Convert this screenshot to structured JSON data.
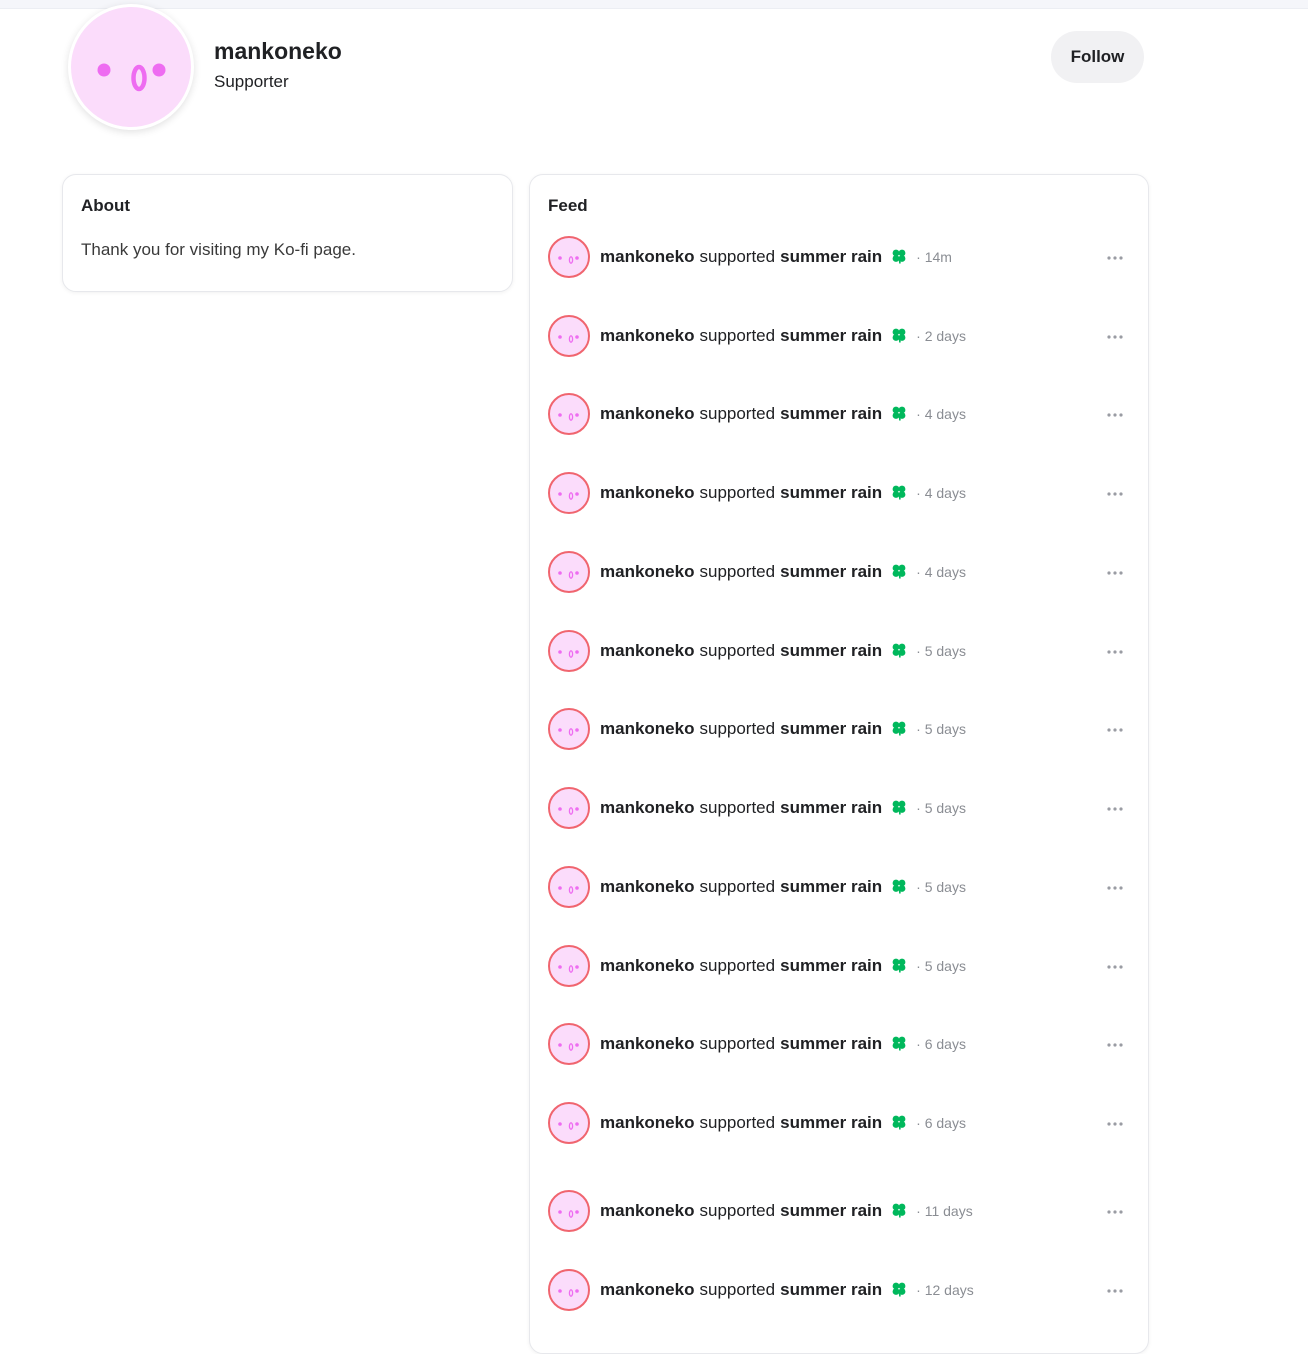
{
  "profile": {
    "name": "mankoneko",
    "role": "Supporter",
    "follow_label": "Follow",
    "avatar_bg": "#fbdcfb",
    "avatar_feature_color": "#ee6cf1"
  },
  "about": {
    "title": "About",
    "text": "Thank you for visiting my Ko-fi page."
  },
  "feed": {
    "title": "Feed",
    "accent_ring_color": "#f0656f",
    "clover_color": "#00b85c",
    "items": [
      {
        "user": "mankoneko",
        "verb": "supported",
        "target": "summer rain",
        "time": "· 14m"
      },
      {
        "user": "mankoneko",
        "verb": "supported",
        "target": "summer rain",
        "time": "· 2 days"
      },
      {
        "user": "mankoneko",
        "verb": "supported",
        "target": "summer rain",
        "time": "· 4 days"
      },
      {
        "user": "mankoneko",
        "verb": "supported",
        "target": "summer rain",
        "time": "· 4 days"
      },
      {
        "user": "mankoneko",
        "verb": "supported",
        "target": "summer rain",
        "time": "· 4 days"
      },
      {
        "user": "mankoneko",
        "verb": "supported",
        "target": "summer rain",
        "time": "· 5 days"
      },
      {
        "user": "mankoneko",
        "verb": "supported",
        "target": "summer rain",
        "time": "· 5 days"
      },
      {
        "user": "mankoneko",
        "verb": "supported",
        "target": "summer rain",
        "time": "· 5 days"
      },
      {
        "user": "mankoneko",
        "verb": "supported",
        "target": "summer rain",
        "time": "· 5 days"
      },
      {
        "user": "mankoneko",
        "verb": "supported",
        "target": "summer rain",
        "time": "· 5 days"
      },
      {
        "user": "mankoneko",
        "verb": "supported",
        "target": "summer rain",
        "time": "· 6 days"
      },
      {
        "user": "mankoneko",
        "verb": "supported",
        "target": "summer rain",
        "time": "· 6 days"
      },
      {
        "user": "mankoneko",
        "verb": "supported",
        "target": "summer rain",
        "time": "· 11 days"
      },
      {
        "user": "mankoneko",
        "verb": "supported",
        "target": "summer rain",
        "time": "· 12 days"
      }
    ]
  }
}
